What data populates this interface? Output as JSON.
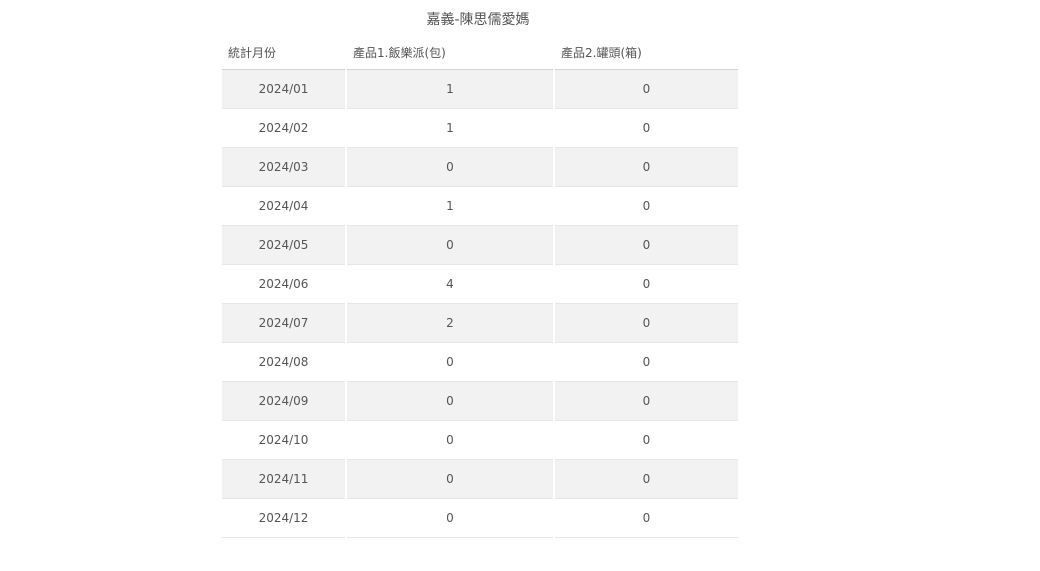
{
  "report": {
    "title": "嘉義-陳思儒愛媽"
  },
  "table": {
    "headers": [
      "統計月份",
      "產品1.飯樂派(包)",
      "產品2.罐頭(箱)"
    ],
    "rows": [
      {
        "month": "2024/01",
        "p1": "1",
        "p2": "0"
      },
      {
        "month": "2024/02",
        "p1": "1",
        "p2": "0"
      },
      {
        "month": "2024/03",
        "p1": "0",
        "p2": "0"
      },
      {
        "month": "2024/04",
        "p1": "1",
        "p2": "0"
      },
      {
        "month": "2024/05",
        "p1": "0",
        "p2": "0"
      },
      {
        "month": "2024/06",
        "p1": "4",
        "p2": "0"
      },
      {
        "month": "2024/07",
        "p1": "2",
        "p2": "0"
      },
      {
        "month": "2024/08",
        "p1": "0",
        "p2": "0"
      },
      {
        "month": "2024/09",
        "p1": "0",
        "p2": "0"
      },
      {
        "month": "2024/10",
        "p1": "0",
        "p2": "0"
      },
      {
        "month": "2024/11",
        "p1": "0",
        "p2": "0"
      },
      {
        "month": "2024/12",
        "p1": "0",
        "p2": "0"
      }
    ]
  }
}
